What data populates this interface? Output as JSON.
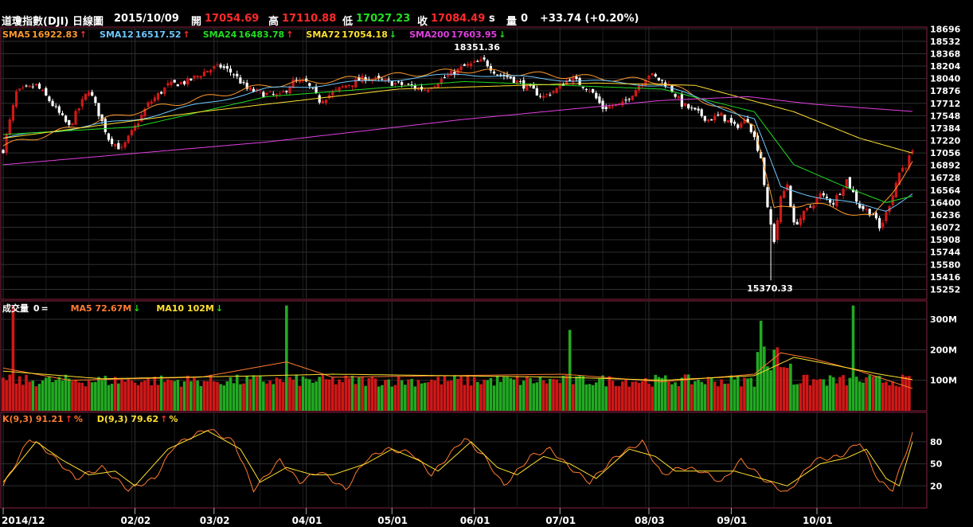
{
  "header": {
    "title": "道瓊指數(DJI)",
    "period": "日線圖",
    "date": "2015/10/09",
    "open_label": "開",
    "open": "17054.69",
    "high_label": "高",
    "high": "17110.88",
    "low_label": "低",
    "low": "17027.23",
    "close_label": "收",
    "close": "17084.49",
    "close_suffix": "s",
    "volume_label": "量",
    "volume": "0",
    "change": "+33.74 (+0.20%)"
  },
  "price_legend": [
    {
      "name": "SMA5",
      "value": "16922.83",
      "arrow": "↑",
      "color": "#ff9a2e"
    },
    {
      "name": "SMA12",
      "value": "16517.52",
      "arrow": "↑",
      "color": "#6ec8ff"
    },
    {
      "name": "SMA24",
      "value": "16483.78",
      "arrow": "↑",
      "color": "#22dd22"
    },
    {
      "name": "SMA72",
      "value": "17054.18",
      "arrow": "↓",
      "color": "#ffe030"
    },
    {
      "name": "SMA200",
      "value": "17603.95",
      "arrow": "↓",
      "color": "#e040e0"
    }
  ],
  "volume_legend": {
    "label": "成交量",
    "value": "0",
    "eq": "=",
    "ma5_label": "MA5 72.67M",
    "ma5_arrow": "↓",
    "ma10_label": "MA10 102M",
    "ma10_arrow": "↓"
  },
  "kd_legend": {
    "k_label": "K(9,3) 91.21",
    "k_arrow": "↑",
    "k_pct": "%",
    "d_label": "D(9,3) 79.62",
    "d_arrow": "↑",
    "d_pct": "%"
  },
  "colors": {
    "up": "#d01818",
    "down": "#ffffff",
    "vol_up": "#d01818",
    "vol_down": "#22aa22",
    "grid": "#2f2f2f",
    "border": "#8a2040",
    "k": "#ff7a30",
    "d": "#ffe030"
  },
  "chart_data": [
    {
      "type": "candlestick",
      "title": "道瓊指數(DJI) 日線圖",
      "x_ticks": [
        "2014/12",
        "02/02",
        "03/02",
        "04/01",
        "05/01",
        "06/01",
        "07/01",
        "08/03",
        "09/01",
        "10/01"
      ],
      "y_ticks": [
        15252,
        15416,
        15580,
        15744,
        15908,
        16072,
        16236,
        16400,
        16564,
        16728,
        16892,
        17056,
        17220,
        17384,
        17548,
        17712,
        17876,
        18040,
        18204,
        18368,
        18532,
        18696
      ],
      "ylim": [
        15120,
        18720
      ],
      "annotations": [
        {
          "text": "18351.36",
          "value": 18351.36
        },
        {
          "text": "15370.33",
          "value": 15370.33
        }
      ],
      "close_key": [
        [
          0,
          17100
        ],
        [
          4,
          17850
        ],
        [
          10,
          17950
        ],
        [
          14,
          17750
        ],
        [
          20,
          17400
        ],
        [
          26,
          17900
        ],
        [
          32,
          17250
        ],
        [
          36,
          17100
        ],
        [
          44,
          17700
        ],
        [
          50,
          17950
        ],
        [
          56,
          18000
        ],
        [
          62,
          18150
        ],
        [
          66,
          18200
        ],
        [
          70,
          18100
        ],
        [
          74,
          17900
        ],
        [
          78,
          17850
        ],
        [
          84,
          17800
        ],
        [
          88,
          18000
        ],
        [
          92,
          17980
        ],
        [
          96,
          17750
        ],
        [
          104,
          17950
        ],
        [
          110,
          18050
        ],
        [
          116,
          18000
        ],
        [
          122,
          17950
        ],
        [
          128,
          17900
        ],
        [
          134,
          18050
        ],
        [
          140,
          18200
        ],
        [
          146,
          18270
        ],
        [
          150,
          18100
        ],
        [
          154,
          18050
        ],
        [
          160,
          17900
        ],
        [
          164,
          17800
        ],
        [
          168,
          17900
        ],
        [
          172,
          18050
        ],
        [
          178,
          17900
        ],
        [
          182,
          17650
        ],
        [
          188,
          17700
        ],
        [
          192,
          17900
        ],
        [
          196,
          18100
        ],
        [
          202,
          17950
        ],
        [
          206,
          17700
        ],
        [
          210,
          17600
        ],
        [
          214,
          17500
        ],
        [
          218,
          17550
        ],
        [
          222,
          17400
        ],
        [
          226,
          17500
        ],
        [
          230,
          17000
        ],
        [
          232,
          16300
        ],
        [
          234,
          15900
        ],
        [
          236,
          16450
        ],
        [
          238,
          16650
        ],
        [
          240,
          16100
        ],
        [
          244,
          16300
        ],
        [
          248,
          16500
        ],
        [
          252,
          16400
        ],
        [
          256,
          16700
        ],
        [
          260,
          16350
        ],
        [
          264,
          16250
        ],
        [
          266,
          16050
        ],
        [
          268,
          16250
        ],
        [
          272,
          16800
        ],
        [
          274,
          16900
        ],
        [
          276,
          17084
        ]
      ],
      "sma_key": {
        "SMA5": [
          [
            0,
            17150
          ],
          [
            40,
            17600
          ],
          [
            80,
            17950
          ],
          [
            140,
            18150
          ],
          [
            200,
            18000
          ],
          [
            228,
            17450
          ],
          [
            234,
            16300
          ],
          [
            244,
            16400
          ],
          [
            264,
            16200
          ],
          [
            276,
            16923
          ]
        ],
        "SMA12": [
          [
            0,
            17250
          ],
          [
            40,
            17500
          ],
          [
            80,
            17900
          ],
          [
            140,
            18100
          ],
          [
            200,
            17950
          ],
          [
            228,
            17500
          ],
          [
            236,
            16600
          ],
          [
            250,
            16450
          ],
          [
            268,
            16300
          ],
          [
            276,
            16518
          ]
        ],
        "SMA24": [
          [
            0,
            17300
          ],
          [
            40,
            17400
          ],
          [
            80,
            17800
          ],
          [
            140,
            18000
          ],
          [
            200,
            17900
          ],
          [
            228,
            17600
          ],
          [
            240,
            16900
          ],
          [
            256,
            16600
          ],
          [
            268,
            16400
          ],
          [
            276,
            16484
          ]
        ],
        "SMA72": [
          [
            0,
            17250
          ],
          [
            60,
            17600
          ],
          [
            120,
            17900
          ],
          [
            180,
            17980
          ],
          [
            210,
            17950
          ],
          [
            240,
            17600
          ],
          [
            260,
            17250
          ],
          [
            276,
            17054
          ]
        ],
        "SMA200": [
          [
            0,
            16900
          ],
          [
            80,
            17200
          ],
          [
            140,
            17500
          ],
          [
            200,
            17750
          ],
          [
            226,
            17800
          ],
          [
            246,
            17700
          ],
          [
            276,
            17604
          ]
        ]
      }
    },
    {
      "type": "bar",
      "title": "成交量",
      "y_ticks": [
        "100M",
        "200M",
        "300M"
      ],
      "ylim": [
        0,
        360
      ],
      "unit": "M",
      "spikes": [
        {
          "index": 3,
          "value": 345
        },
        {
          "index": 86,
          "value": 345
        },
        {
          "index": 172,
          "value": 265
        },
        {
          "index": 230,
          "value": 295
        },
        {
          "index": 258,
          "value": 345
        }
      ],
      "baseline": 95,
      "ma_key": {
        "MA5": [
          [
            0,
            140
          ],
          [
            20,
            100
          ],
          [
            60,
            110
          ],
          [
            86,
            160
          ],
          [
            100,
            110
          ],
          [
            170,
            120
          ],
          [
            200,
            95
          ],
          [
            228,
            120
          ],
          [
            236,
            190
          ],
          [
            246,
            170
          ],
          [
            260,
            130
          ],
          [
            276,
            73
          ]
        ],
        "MA10": [
          [
            0,
            130
          ],
          [
            30,
            105
          ],
          [
            80,
            115
          ],
          [
            100,
            120
          ],
          [
            170,
            110
          ],
          [
            200,
            100
          ],
          [
            228,
            115
          ],
          [
            240,
            175
          ],
          [
            252,
            150
          ],
          [
            266,
            120
          ],
          [
            276,
            102
          ]
        ]
      }
    },
    {
      "type": "line",
      "title": "KD(9,3)",
      "y_ticks": [
        20,
        50,
        80
      ],
      "ylim": [
        -10,
        120
      ],
      "series": [
        {
          "name": "K(9,3)",
          "values_key": [
            [
              0,
              20
            ],
            [
              8,
              85
            ],
            [
              14,
              65
            ],
            [
              22,
              30
            ],
            [
              30,
              45
            ],
            [
              38,
              15
            ],
            [
              46,
              30
            ],
            [
              52,
              75
            ],
            [
              62,
              98
            ],
            [
              70,
              80
            ],
            [
              76,
              15
            ],
            [
              84,
              55
            ],
            [
              90,
              25
            ],
            [
              96,
              40
            ],
            [
              104,
              15
            ],
            [
              110,
              55
            ],
            [
              116,
              70
            ],
            [
              124,
              65
            ],
            [
              130,
              35
            ],
            [
              140,
              85
            ],
            [
              146,
              60
            ],
            [
              152,
              20
            ],
            [
              160,
              60
            ],
            [
              166,
              70
            ],
            [
              172,
              45
            ],
            [
              178,
              25
            ],
            [
              186,
              60
            ],
            [
              194,
              80
            ],
            [
              200,
              35
            ],
            [
              206,
              45
            ],
            [
              212,
              40
            ],
            [
              218,
              25
            ],
            [
              224,
              55
            ],
            [
              232,
              25
            ],
            [
              238,
              10
            ],
            [
              246,
              55
            ],
            [
              254,
              60
            ],
            [
              260,
              80
            ],
            [
              266,
              25
            ],
            [
              270,
              15
            ],
            [
              276,
              91
            ]
          ]
        },
        {
          "name": "D(9,3)",
          "values_key": [
            [
              0,
              25
            ],
            [
              10,
              80
            ],
            [
              18,
              55
            ],
            [
              26,
              35
            ],
            [
              34,
              40
            ],
            [
              40,
              20
            ],
            [
              50,
              70
            ],
            [
              62,
              95
            ],
            [
              72,
              70
            ],
            [
              78,
              25
            ],
            [
              86,
              45
            ],
            [
              94,
              35
            ],
            [
              100,
              35
            ],
            [
              110,
              50
            ],
            [
              118,
              70
            ],
            [
              126,
              55
            ],
            [
              132,
              40
            ],
            [
              142,
              80
            ],
            [
              150,
              45
            ],
            [
              156,
              35
            ],
            [
              164,
              60
            ],
            [
              172,
              50
            ],
            [
              180,
              30
            ],
            [
              190,
              70
            ],
            [
              198,
              60
            ],
            [
              204,
              40
            ],
            [
              214,
              40
            ],
            [
              222,
              40
            ],
            [
              230,
              30
            ],
            [
              238,
              20
            ],
            [
              248,
              50
            ],
            [
              256,
              58
            ],
            [
              262,
              70
            ],
            [
              268,
              30
            ],
            [
              272,
              20
            ],
            [
              276,
              80
            ]
          ]
        }
      ]
    }
  ]
}
